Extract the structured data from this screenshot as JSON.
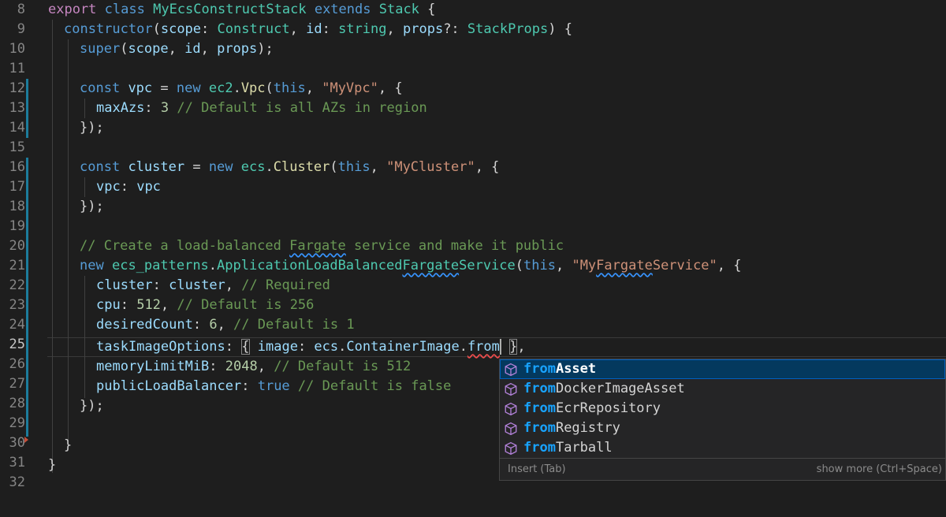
{
  "editor": {
    "line_numbers": [
      "8",
      "9",
      "10",
      "11",
      "12",
      "13",
      "14",
      "15",
      "16",
      "17",
      "18",
      "19",
      "20",
      "21",
      "22",
      "23",
      "24",
      "25",
      "26",
      "27",
      "28",
      "29",
      "30",
      "31",
      "32"
    ],
    "active_line": "25"
  },
  "code": {
    "l8": [
      "export",
      " ",
      "class",
      " ",
      "MyEcsConstructStack",
      " ",
      "extends",
      " ",
      "Stack",
      " {"
    ],
    "l9": [
      "constructor",
      "(",
      "scope",
      ": ",
      "Construct",
      ", ",
      "id",
      ": ",
      "string",
      ", ",
      "props",
      "?: ",
      "StackProps",
      ") {"
    ],
    "l10": [
      "super",
      "(",
      "scope",
      ", ",
      "id",
      ", ",
      "props",
      ");"
    ],
    "l12": [
      "const",
      " ",
      "vpc",
      " = ",
      "new",
      " ",
      "ec2",
      ".",
      "Vpc",
      "(",
      "this",
      ", ",
      "\"MyVpc\"",
      ", {"
    ],
    "l13": [
      "maxAzs",
      ": ",
      "3",
      " ",
      "// Default is all AZs in region"
    ],
    "l14": [
      "});"
    ],
    "l16": [
      "const",
      " ",
      "cluster",
      " = ",
      "new",
      " ",
      "ecs",
      ".",
      "Cluster",
      "(",
      "this",
      ", ",
      "\"MyCluster\"",
      ", {"
    ],
    "l17": [
      "vpc",
      ": ",
      "vpc"
    ],
    "l18": [
      "});"
    ],
    "l20": [
      "// Create a load-balanced ",
      "Fargate",
      " service and make it public"
    ],
    "l21": [
      "new",
      " ",
      "ecs_patterns",
      ".",
      "ApplicationLoadBalanced",
      "Fargate",
      "Service",
      "(",
      "this",
      ", ",
      "\"My",
      "Fargate",
      "Service\"",
      ", {"
    ],
    "l22": [
      "cluster",
      ": ",
      "cluster",
      ", ",
      "// Required"
    ],
    "l23": [
      "cpu",
      ": ",
      "512",
      ", ",
      "// Default is 256"
    ],
    "l24": [
      "desiredCount",
      ": ",
      "6",
      ", ",
      "// Default is 1"
    ],
    "l25": [
      "taskImageOptions",
      ": ",
      "{",
      " ",
      "image",
      ": ",
      "ecs",
      ".",
      "ContainerImage",
      ".",
      "from",
      " ",
      "}",
      ","
    ],
    "l26": [
      "memoryLimitMiB",
      ": ",
      "2048",
      ", ",
      "// Default is 512"
    ],
    "l27": [
      "publicLoadBalancer",
      ": ",
      "true",
      " ",
      "// Default is false"
    ],
    "l28": [
      "});"
    ],
    "l30": [
      "}"
    ],
    "l31": [
      "}"
    ]
  },
  "suggest": {
    "prefix": "from",
    "items": [
      {
        "match": "from",
        "rest": "Asset",
        "icon": "cube-icon"
      },
      {
        "match": "from",
        "rest": "DockerImageAsset",
        "icon": "cube-icon"
      },
      {
        "match": "from",
        "rest": "EcrRepository",
        "icon": "cube-icon"
      },
      {
        "match": "from",
        "rest": "Registry",
        "icon": "cube-icon"
      },
      {
        "match": "from",
        "rest": "Tarball",
        "icon": "cube-icon"
      }
    ],
    "footer_left": "Insert (Tab)",
    "footer_right": "show more (Ctrl+Space)"
  },
  "colors": {
    "background": "#1e1e1e",
    "keyword": "#569cd6",
    "control": "#c586c0",
    "type": "#4ec9b0",
    "function": "#dcdcaa",
    "variable": "#9cdcfe",
    "string": "#ce9178",
    "number": "#b5cea8",
    "comment": "#6a9955",
    "match_highlight": "#18a3ff",
    "selection": "#04395e"
  }
}
